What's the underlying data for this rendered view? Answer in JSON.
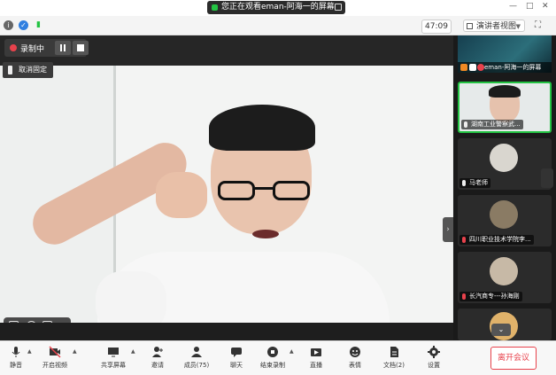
{
  "top": {
    "notice_text": "您正在观看eman-阿海一的屏幕"
  },
  "infobar": {
    "timer": "47:09",
    "view_label": "演讲者视图"
  },
  "recording": {
    "label": "录制中"
  },
  "pin": {
    "label": "取消固定"
  },
  "sidebar": {
    "screen_share_label": "eman-阿海一的屏幕",
    "tiles": [
      {
        "name": "湖南工业警察武..."
      },
      {
        "name": "马老师"
      },
      {
        "name": "四川职业技术学院李..."
      },
      {
        "name": "长汽商专---孙海刚"
      }
    ]
  },
  "toolbar": {
    "items": [
      {
        "label": "静音"
      },
      {
        "label": "开启视频"
      },
      {
        "label": "共享屏幕"
      },
      {
        "label": "邀请"
      },
      {
        "label": "成员(75)"
      },
      {
        "label": "聊天"
      },
      {
        "label": "结束录制"
      },
      {
        "label": "直播"
      },
      {
        "label": "表情"
      },
      {
        "label": "文档(2)"
      },
      {
        "label": "设置"
      }
    ],
    "end_meeting": "离开会议"
  },
  "colors": {
    "accent_red": "#e8424c",
    "accent_green": "#23c343",
    "toolbar_bg": "#f7f7f7",
    "stage_bg": "#262626"
  }
}
